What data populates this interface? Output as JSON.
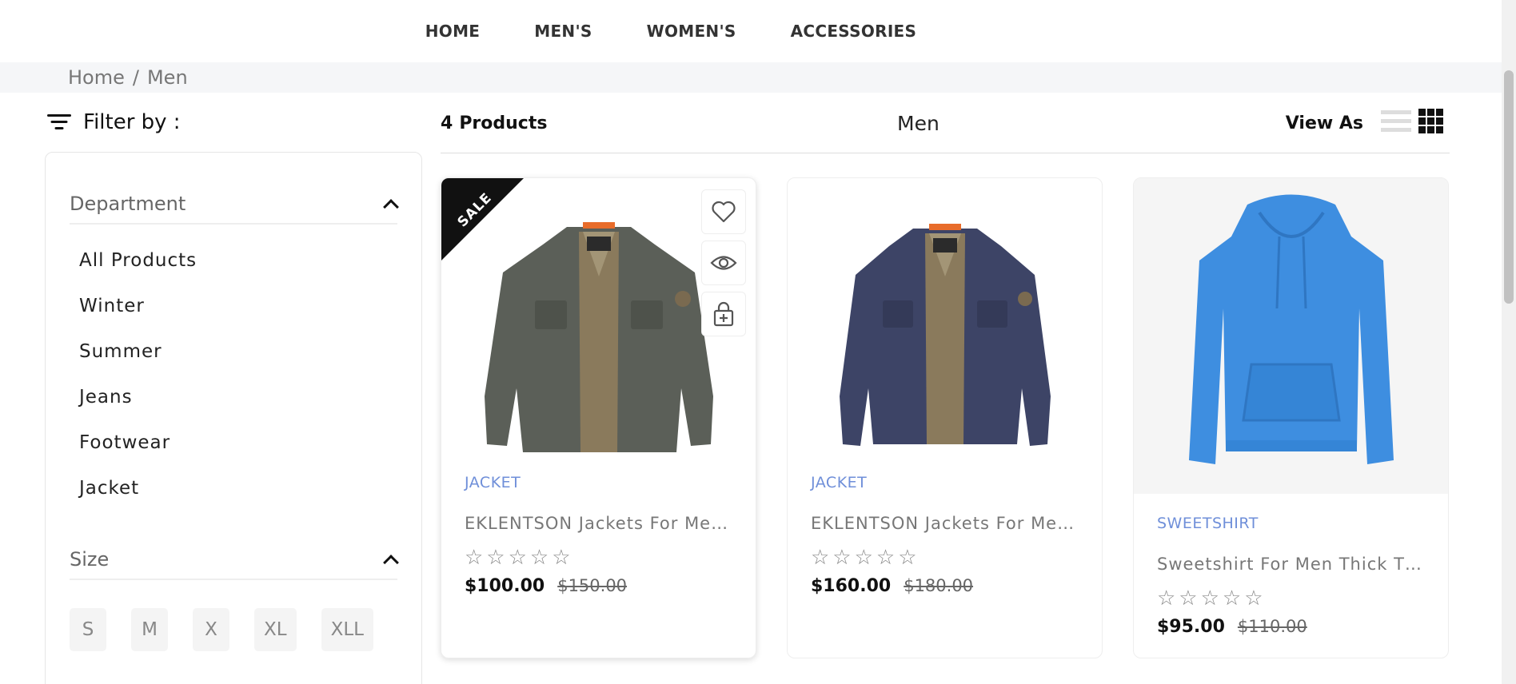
{
  "nav": [
    "HOME",
    "MEN'S",
    "WOMEN'S",
    "ACCESSORIES"
  ],
  "breadcrumb": {
    "home": "Home",
    "separator": "/",
    "current": "Men"
  },
  "filter": {
    "title": "Filter by :",
    "department": {
      "label": "Department",
      "items": [
        "All Products",
        "Winter",
        "Summer",
        "Jeans",
        "Footwear",
        "Jacket"
      ]
    },
    "size": {
      "label": "Size",
      "options": [
        "S",
        "M",
        "X",
        "XL",
        "XLL"
      ]
    }
  },
  "toolbar": {
    "count": "4",
    "count_label": "Products",
    "category_title": "Men",
    "view_as": "View As"
  },
  "products": [
    {
      "category": "JACKET",
      "name": "EKLENTSON Jackets For Men…",
      "price": "$100.00",
      "old_price": "$150.00",
      "badge": "SALE",
      "rating": "☆☆☆☆☆",
      "jacket_color": "#5b5f58"
    },
    {
      "category": "JACKET",
      "name": "EKLENTSON Jackets For Men…",
      "price": "$160.00",
      "old_price": "$180.00",
      "rating": "☆☆☆☆☆",
      "jacket_color": "#3d4466"
    },
    {
      "category": "SWEETSHIRT",
      "name": "Sweetshirt For Men Thick Th…",
      "price": "$95.00",
      "old_price": "$110.00",
      "rating": "☆☆☆☆☆",
      "hoodie_color": "#3e8ee0"
    }
  ],
  "colors": {
    "accent_link": "#6f8fd9",
    "breadcrumb_bg": "#f5f6f8"
  }
}
